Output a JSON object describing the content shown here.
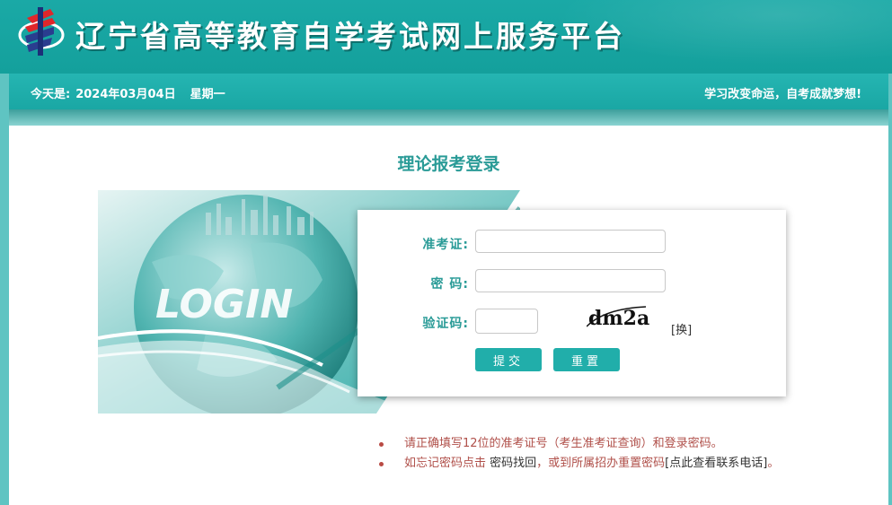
{
  "header": {
    "title": "辽宁省高等教育自学考试网上服务平台"
  },
  "infobar": {
    "today_label": "今天是:",
    "date": "2024年03月04日",
    "weekday": "星期一",
    "slogan": "学习改变命运，自考成就梦想!"
  },
  "main": {
    "title": "理论报考登录",
    "banner_text": "LOGIN"
  },
  "form": {
    "exam_id_label": "准考证:",
    "password_label": "密 码:",
    "captcha_label": "验证码:",
    "exam_id_value": "",
    "password_value": "",
    "captcha_value": "",
    "captcha_text": "dm2a",
    "refresh_label": "[换]",
    "submit_label": "提交",
    "reset_label": "重置"
  },
  "notes": {
    "line1_a": "请正确填写12位的准考证号（",
    "line1_link": "考生准考证查询",
    "line1_b": "）和登录密码。",
    "line2_a": "如忘记密码点击 ",
    "line2_link": "密码找回",
    "line2_b": "，或到所属招办重置密码",
    "line2_link2": "[点此查看联系电话]",
    "line2_c": "。"
  },
  "colors": {
    "brand_teal": "#1aa9a6",
    "title_teal": "#2a9b97",
    "note_red": "#b0504a",
    "button": "#21aeaa"
  }
}
